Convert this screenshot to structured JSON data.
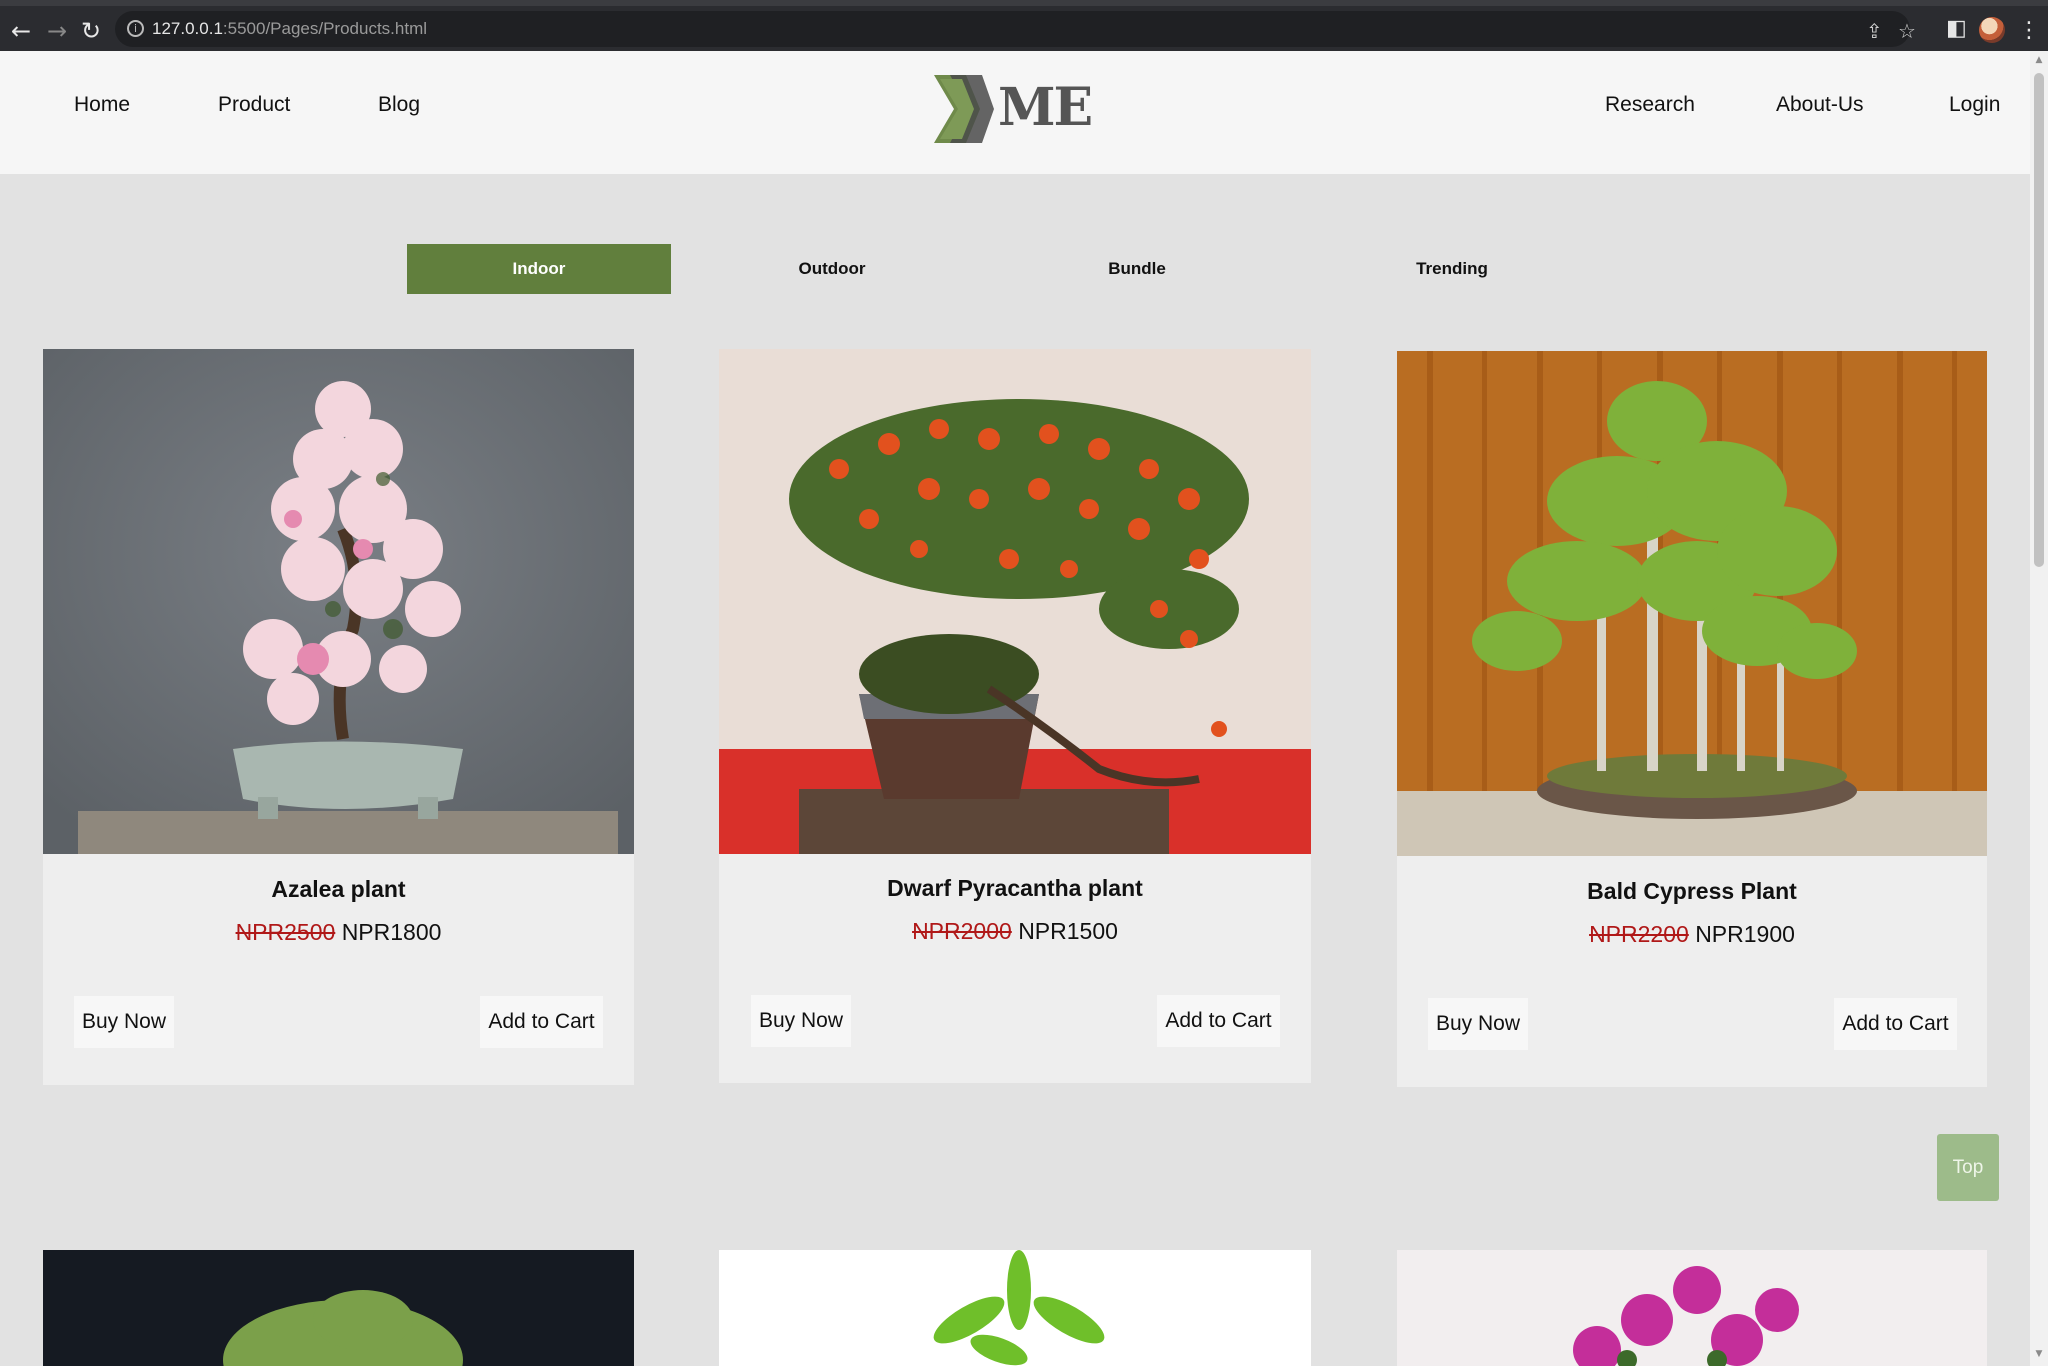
{
  "browser": {
    "url_host": "127.0.0.1",
    "url_rest": ":5500/Pages/Products.html"
  },
  "header": {
    "nav_left": [
      "Home",
      "Product",
      "Blog"
    ],
    "nav_right": [
      "Research",
      "About-Us",
      "Login"
    ],
    "logo_text": "ME"
  },
  "tabs": [
    "Indoor",
    "Outdoor",
    "Bundle",
    "Trending"
  ],
  "products": [
    {
      "name": "Azalea plant",
      "old_price": "NPR2500",
      "price": "NPR1800",
      "buy": "Buy Now",
      "cart": "Add to Cart"
    },
    {
      "name": "Dwarf Pyracantha plant",
      "old_price": "NPR2000",
      "price": "NPR1500",
      "buy": "Buy Now",
      "cart": "Add to Cart"
    },
    {
      "name": "Bald Cypress Plant",
      "old_price": "NPR2200",
      "price": "NPR1900",
      "buy": "Buy Now",
      "cart": "Add to Cart"
    }
  ],
  "top_button": "Top",
  "colors": {
    "accent": "#617f3d",
    "top_button": "#9dbb8a",
    "old_price": "#b01818"
  },
  "icons": [
    "back-icon",
    "forward-icon",
    "reload-icon",
    "info-icon",
    "share-icon",
    "star-icon",
    "sidepanel-icon",
    "menu-icon"
  ]
}
